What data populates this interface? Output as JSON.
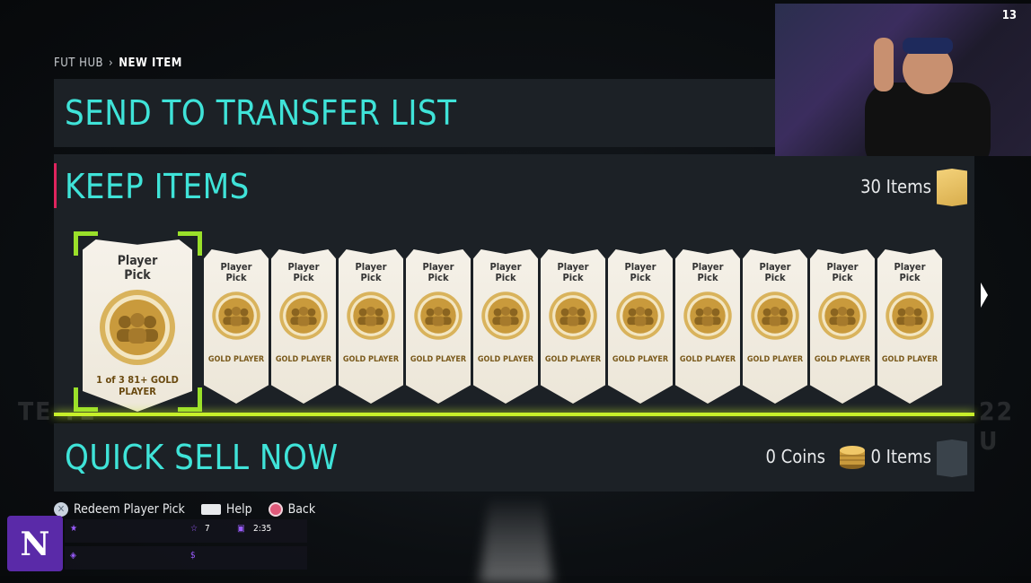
{
  "breadcrumb": {
    "root": "FUT HUB",
    "current": "NEW ITEM"
  },
  "send_panel": {
    "title": "SEND TO TRANSFER LIST"
  },
  "keep_panel": {
    "title": "KEEP ITEMS",
    "count": "30 Items",
    "selected_card": {
      "title_line1": "Player",
      "title_line2": "Pick",
      "subtitle": "1 of 3 81+ GOLD PLAYER"
    },
    "cards": [
      {
        "title_line1": "Player",
        "title_line2": "Pick",
        "subtitle": "GOLD PLAYER"
      },
      {
        "title_line1": "Player",
        "title_line2": "Pick",
        "subtitle": "GOLD PLAYER"
      },
      {
        "title_line1": "Player",
        "title_line2": "Pick",
        "subtitle": "GOLD PLAYER"
      },
      {
        "title_line1": "Player",
        "title_line2": "Pick",
        "subtitle": "GOLD PLAYER"
      },
      {
        "title_line1": "Player",
        "title_line2": "Pick",
        "subtitle": "GOLD PLAYER"
      },
      {
        "title_line1": "Player",
        "title_line2": "Pick",
        "subtitle": "GOLD PLAYER"
      },
      {
        "title_line1": "Player",
        "title_line2": "Pick",
        "subtitle": "GOLD PLAYER"
      },
      {
        "title_line1": "Player",
        "title_line2": "Pick",
        "subtitle": "GOLD PLAYER"
      },
      {
        "title_line1": "Player",
        "title_line2": "Pick",
        "subtitle": "GOLD PLAYER"
      },
      {
        "title_line1": "Player",
        "title_line2": "Pick",
        "subtitle": "GOLD PLAYER"
      },
      {
        "title_line1": "Player",
        "title_line2": "Pick",
        "subtitle": "GOLD PLAYER"
      }
    ]
  },
  "quick_panel": {
    "title": "QUICK SELL NOW",
    "coins": "0 Coins",
    "items": "0 Items"
  },
  "hints": [
    {
      "label": "Redeem Player Pick",
      "icon": "cross-button-icon"
    },
    {
      "label": "Help",
      "icon": "touchpad-icon"
    },
    {
      "label": "Back",
      "icon": "circle-button-icon"
    }
  ],
  "webcam": {
    "count": "13"
  },
  "stream_bar": {
    "stat1": "7",
    "time": "2:35"
  },
  "colors": {
    "accent_teal": "#3fe3d8",
    "selection_green": "#9ae02a",
    "highlight_line": "#c8f02a",
    "keep_accent": "#e0245e",
    "panel_bg": "#1c2126"
  }
}
